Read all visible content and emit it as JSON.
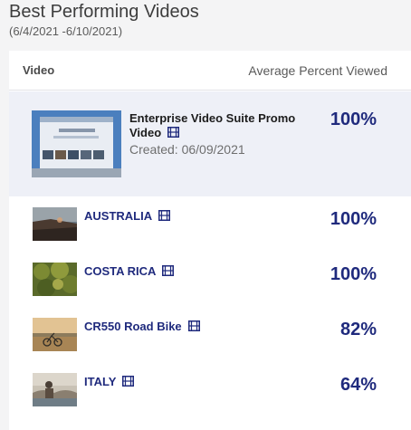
{
  "title": "Best Performing Videos",
  "date_range": "(6/4/2021 -6/10/2021)",
  "table": {
    "col_video": "Video",
    "col_avg": "Average Percent Viewed"
  },
  "featured": {
    "title": "Enterprise Video Suite Promo Video",
    "created": "Created: 06/09/2021",
    "percent": "100%"
  },
  "rows": [
    {
      "title": "AUSTRALIA",
      "percent": "100%"
    },
    {
      "title": "COSTA RICA",
      "percent": "100%"
    },
    {
      "title": "CR550 Road Bike",
      "percent": "82%"
    },
    {
      "title": "ITALY",
      "percent": "64%"
    }
  ],
  "icons": {
    "film": "film-icon"
  },
  "colors": {
    "accent": "#1f2a7d",
    "featured_bg": "#eef0f7"
  }
}
